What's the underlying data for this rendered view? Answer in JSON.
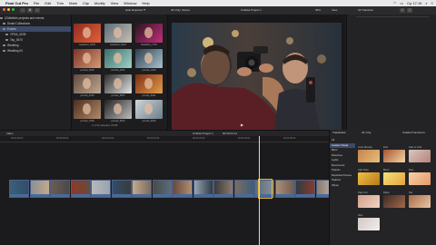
{
  "menubar": {
    "app": "Final Cut Pro",
    "items": [
      "File",
      "Edit",
      "Trim",
      "Mark",
      "Clip",
      "Modify",
      "View",
      "Window",
      "Help"
    ],
    "clock": "Ср 17:19"
  },
  "toolbar": {
    "hide_rejected": "Hide Rejected",
    "viewer_mode": "4K Only, Stereo",
    "project_title": "Untitled Project 1",
    "zoom": "35%",
    "view_label": "View",
    "inspector_title": "All Transition"
  },
  "library": {
    "items": [
      {
        "label": "ICMeidia's projects and events",
        "selected": false
      },
      {
        "label": "Smart Collections",
        "selected": false
      },
      {
        "label": "Events",
        "selected": true
      },
      {
        "label": "YPSA_0039",
        "selected": false
      },
      {
        "label": "Tay_0670",
        "selected": false
      },
      {
        "label": "Wedding",
        "selected": false
      },
      {
        "label": "Wedding 04",
        "selected": false
      }
    ]
  },
  "browser": {
    "thumbs": [
      {
        "label": "headshot_5445"
      },
      {
        "label": "headshot_6201"
      },
      {
        "label": "headshot_7710"
      },
      {
        "label": "portrait_0315"
      },
      {
        "label": "portrait_2201"
      },
      {
        "label": "portrait_3116"
      },
      {
        "label": "portrait_4410"
      },
      {
        "label": "portrait_5507"
      },
      {
        "label": "portrait_6621"
      },
      {
        "label": "portrait_7018"
      },
      {
        "label": "portrait_8104"
      },
      {
        "label": "portrait_9020"
      }
    ],
    "footer": "1 of 94 selected, 00:08"
  },
  "timeline": {
    "index_label": "Index",
    "timecode": "00:00:04:14",
    "project_label": "Untitled Project 1",
    "ruler": [
      "00:00:00:00",
      "00:00:05:00",
      "00:00:10:00",
      "00:00:15:00",
      "00:00:20:00",
      "00:00:25:00",
      "00:00:30:00",
      "00:00:35:00"
    ]
  },
  "effects": {
    "title": "Transitions",
    "filter": "4K Only",
    "installed": "Installed Transitions",
    "categories": [
      "All",
      "Custom Visual",
      "Blurs",
      "Dissolves",
      "Lights",
      "Movements",
      "Objects",
      "Replicator/Clones",
      "Stylized",
      "Wipes"
    ],
    "tiles": [
      {
        "name": "Cross Dissolve",
        "c1": "#c8814a",
        "c2": "#e7c07d"
      },
      {
        "name": "Flow",
        "c1": "#a75530",
        "c2": "#f3d5a8"
      },
      {
        "name": "Fade to Color",
        "c1": "#d8c7c2",
        "c2": "#b78477"
      },
      {
        "name": "Light Noise",
        "c1": "#f0c046",
        "c2": "#b77918"
      },
      {
        "name": "Bloom",
        "c1": "#f3e37a",
        "c2": "#e5a23e"
      },
      {
        "name": "Flare",
        "c1": "#f7d2a7",
        "c2": "#e6986a"
      },
      {
        "name": "Page Curl",
        "c1": "#d3a08c",
        "c2": "#f0d2c4"
      },
      {
        "name": "Ripple",
        "c1": "#3b2a24",
        "c2": "#a46a4c"
      },
      {
        "name": "Star",
        "c1": "#aa6b4a",
        "c2": "#e9c7a4"
      },
      {
        "name": "Wipe",
        "c1": "#d2c8c4",
        "c2": "#f2eeee"
      }
    ]
  },
  "colors": {
    "accent": "#3c4a66",
    "clip_border": "#4b5c80",
    "playhead": "#d8d8d8"
  }
}
